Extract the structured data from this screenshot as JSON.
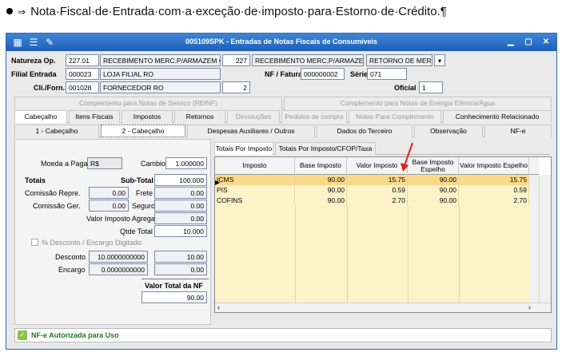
{
  "doc_heading": "Nota·Fiscal·de·Entrada·com·a·exceção·de·imposto·para·Estorno·de·Crédito.¶",
  "window": {
    "title": "005109SPK - Entradas de Notas Fiscais de Consumíveis",
    "minimize": "▁",
    "restore": "▢",
    "close": "✕"
  },
  "header": {
    "natureza_label": "Natureza Op.",
    "natureza_code": "227.01",
    "natureza_desc": "RECEBIMENTO MERC.P/ARMAZEM OU DE",
    "natureza_code2": "227",
    "natureza_desc2": "RECEBIMENTO MERC.P/ARMAZEM OU",
    "natureza_desc3": "RETORNO DE MERCAI",
    "filial_label": "Filial Entrada",
    "filial_code": "000023",
    "filial_name": "LOJA FILIAL RO",
    "nf_label": "NF / Fatura",
    "nf_value": "000000002",
    "serie_label": "Série",
    "serie_value": "071",
    "cli_label": "Cli./Forn.",
    "cli_code": "001028",
    "cli_name": "FORNECEDOR RO",
    "cli_seq": "2",
    "oficial_label": "Oficial",
    "oficial_value": "1"
  },
  "tabs_top": [
    "Complemento para Notas de Serviço (REINF)",
    "Complemento para Notas de Energia Elétrica/Água"
  ],
  "tabs_main": [
    "Cabeçalho",
    "Itens Fiscais",
    "Impostos",
    "Retornos",
    "Devoluções",
    "Pedidos de compra",
    "Notas Para Complemento",
    "Conhecimento Relacionado"
  ],
  "tabs_sub": [
    "1 - Cabeçalho",
    "2 - Cabeçalho",
    "Despesas Auxiliares / Outros",
    "Dados do Terceiro",
    "Observação",
    "NF-e"
  ],
  "left": {
    "moeda_label": "Moeda a Pagar",
    "moeda_value": "R$",
    "cambio_label": "Cambio",
    "cambio_value": "1.000000",
    "totais_label": "Totais",
    "subtotal_label": "Sub-Total",
    "subtotal_value": "100.000",
    "comissao_rep_label": "Comissão Repre.",
    "comissao_rep_value": "0.00",
    "frete_label": "Frete",
    "frete_value": "0.00",
    "comissao_ger_label": "Comissão Ger.",
    "comissao_ger_value": "0.00",
    "seguro_label": "Seguro",
    "seguro_value": "0.00",
    "valor_agregar_label": "Valor Imposto Agregar",
    "valor_agregar_value": "0.00",
    "qtde_label": "Qtde Total",
    "qtde_value": "10.000",
    "pct_desc_label": "% Desconto / Encargo Digitado",
    "desconto_label": "Desconto",
    "desconto_rate": "10.0000000000",
    "desconto_value": "10.00",
    "encargo_label": "Encargo",
    "encargo_rate": "0.0000000000",
    "encargo_value": "0.00",
    "valor_total_label": "Valor Total da NF",
    "valor_total_value": "90.00"
  },
  "right_tabs": [
    "Totais Por Imposto",
    "Totais Por Imposto/CFOP/Taxa"
  ],
  "table": {
    "headers": [
      "Imposto",
      "Base Imposto",
      "Valor Imposto",
      "Base Imposto Espelho",
      "Valor Imposto Espelho"
    ],
    "rows": [
      [
        "ICMS",
        "90.00",
        "15.75",
        "90.00",
        "15.75"
      ],
      [
        "PIS",
        "90.00",
        "0.59",
        "90.00",
        "0.59"
      ],
      [
        "COFINS",
        "90.00",
        "2.70",
        "90.00",
        "2.70"
      ]
    ]
  },
  "status_text": "NF-e Autorizada para Uso"
}
